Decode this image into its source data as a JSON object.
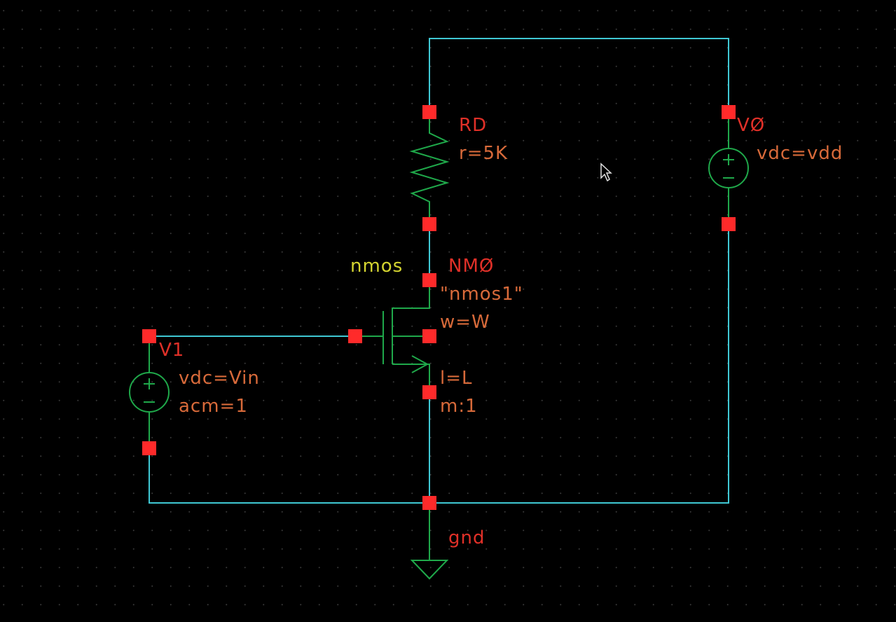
{
  "colors": {
    "background": "#000000",
    "wire": "#3fc8d4",
    "symbol": "#1fa84a",
    "pin": "#ff2a2a",
    "instance_name": "#e03028",
    "parameter": "#d86a3a",
    "cell_name": "#d4d430",
    "grid_dot": "#3a3a3a"
  },
  "schematic": {
    "resistor": {
      "instance": "RD",
      "params": [
        "r=5K"
      ]
    },
    "vdd_source": {
      "instance": "VØ",
      "params": [
        "vdc=vdd"
      ]
    },
    "transistor": {
      "cell": "nmos",
      "instance": "NMØ",
      "params": [
        "\"nmos1\"",
        "w=W",
        "l=L",
        "m:1"
      ]
    },
    "input_source": {
      "instance": "V1",
      "params": [
        "vdc=Vin",
        "acm=1"
      ]
    },
    "ground": {
      "label": "gnd"
    }
  }
}
